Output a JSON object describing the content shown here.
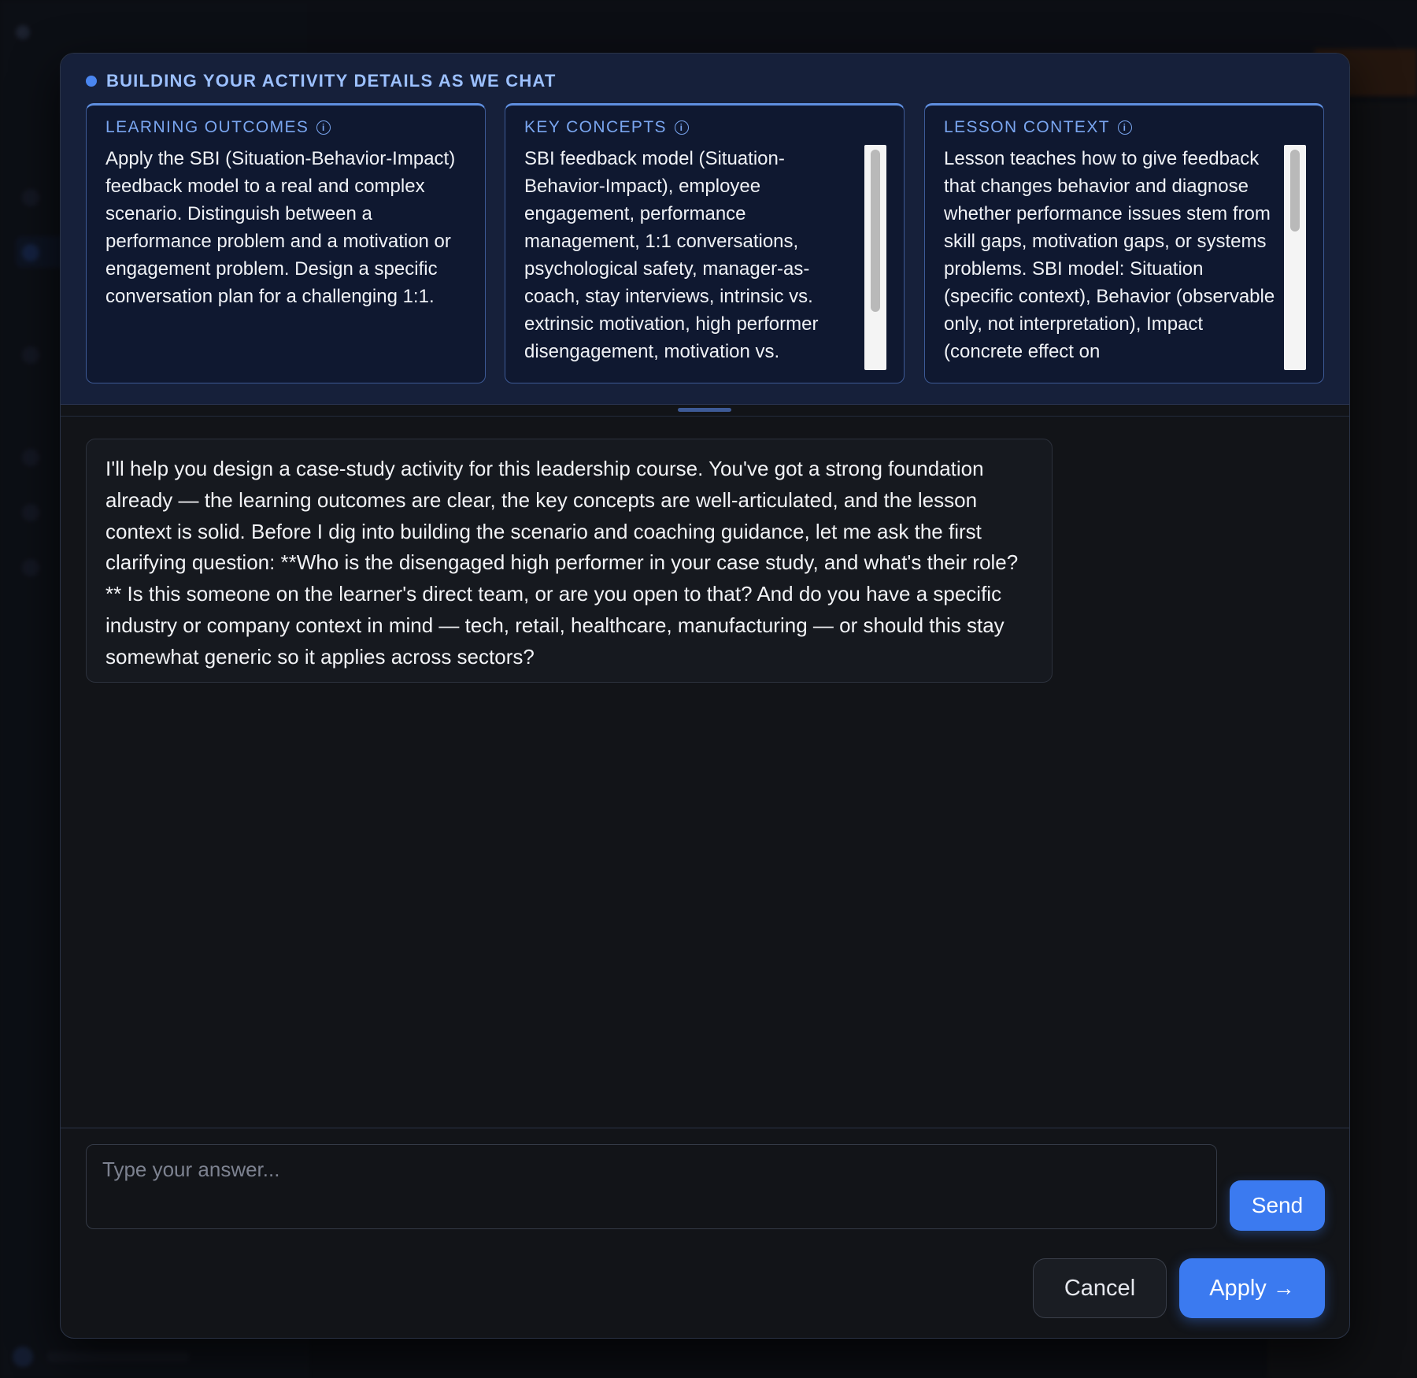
{
  "header": {
    "status_text": "BUILDING YOUR ACTIVITY DETAILS AS WE CHAT",
    "accent_color": "#4a86f0"
  },
  "cards": [
    {
      "title": "LEARNING OUTCOMES",
      "icon": "info-icon",
      "body": "Apply the SBI (Situation-Behavior-Impact) feedback model to a real and complex scenario. Distinguish between a performance problem and a motivation or engagement problem. Design a specific conversation plan for a challenging 1:1."
    },
    {
      "title": "KEY CONCEPTS",
      "icon": "info-icon",
      "body": "SBI feedback model (Situation-Behavior-Impact), employee engagement, performance management, 1:1 conversations, psychological safety, manager-as-coach, stay interviews, intrinsic vs. extrinsic motivation, high performer disengagement, motivation vs."
    },
    {
      "title": "LESSON CONTEXT",
      "icon": "info-icon",
      "body": "Lesson teaches how to give feedback that changes behavior and diagnose whether performance issues stem from skill gaps, motivation gaps, or systems problems. SBI model: Situation (specific context), Behavior (observable only, not interpretation), Impact (concrete effect on"
    }
  ],
  "chat": {
    "assistant_message": "I'll help you design a case-study activity for this leadership course. You've got a strong foundation already — the learning outcomes are clear, the key concepts are well-articulated, and the lesson context is solid. Before I dig into building the scenario and coaching guidance, let me ask the first clarifying question: **Who is the disengaged high performer in your case study, and what's their role?** Is this someone on the learner's direct team, or are you open to that? And do you have a specific industry or company context in mind — tech, retail, healthcare, manufacturing — or should this stay somewhat generic so it applies across sectors?"
  },
  "input": {
    "placeholder": "Type your answer...",
    "value": ""
  },
  "buttons": {
    "send": "Send",
    "cancel": "Cancel",
    "apply": "Apply",
    "apply_icon": "arrow-right-icon"
  }
}
